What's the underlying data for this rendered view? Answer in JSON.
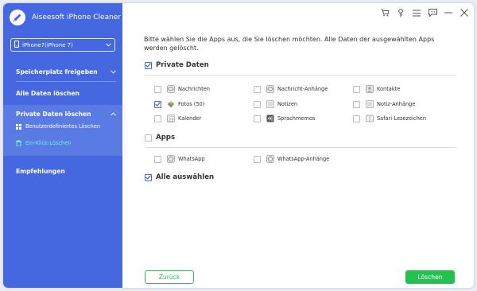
{
  "app": {
    "title": "Aiseesoft iPhone Cleaner",
    "logo_icon": "broom-icon"
  },
  "device": {
    "label": "iPhone7(iPhone 7)",
    "icon": "phone-icon"
  },
  "sidebar": {
    "items": [
      {
        "label": "Speicherplatz freigeben"
      },
      {
        "label": "Alle Daten löschen"
      },
      {
        "label": "Private Daten löschen"
      },
      {
        "label": "Empfehlungen"
      }
    ],
    "sub_items": [
      {
        "label": "Benutzerdefiniertes Löschen",
        "icon": "grid-icon"
      },
      {
        "label": "Ein-Klick-Löschen",
        "icon": "trash-icon"
      }
    ]
  },
  "main": {
    "intro": "Bitte wählen Sie die Apps aus, die Sie löschen möchten. Alle Daten der ausgewählten Apps werden gelöscht.",
    "private": {
      "title": "Private Daten",
      "checked": true,
      "options": [
        {
          "label": "Nachrichten",
          "checked": false
        },
        {
          "label": "Nachricht-Anhänge",
          "checked": false
        },
        {
          "label": "Kontakte",
          "checked": false
        },
        {
          "label": "Fotos (50)",
          "checked": true
        },
        {
          "label": "Notizen",
          "checked": false
        },
        {
          "label": "Notiz-Anhänge",
          "checked": false
        },
        {
          "label": "Kalender",
          "checked": false
        },
        {
          "label": "Sprachmemos",
          "checked": false
        },
        {
          "label": "Safari-Lesezeichen",
          "checked": false
        }
      ]
    },
    "apps": {
      "title": "Apps",
      "checked": false,
      "options": [
        {
          "label": "WhatsApp",
          "checked": false
        },
        {
          "label": "WhatsApp-Anhänge",
          "checked": false
        }
      ]
    },
    "select_all": {
      "label": "Alle auswählen",
      "checked": true
    }
  },
  "buttons": {
    "back": "Zurück",
    "delete": "Löschen"
  },
  "colors": {
    "sidebar": "#4567df",
    "accent_green": "#25c150",
    "active_sub": "#6cf3e0",
    "checkbox_blue": "#4a68de"
  }
}
